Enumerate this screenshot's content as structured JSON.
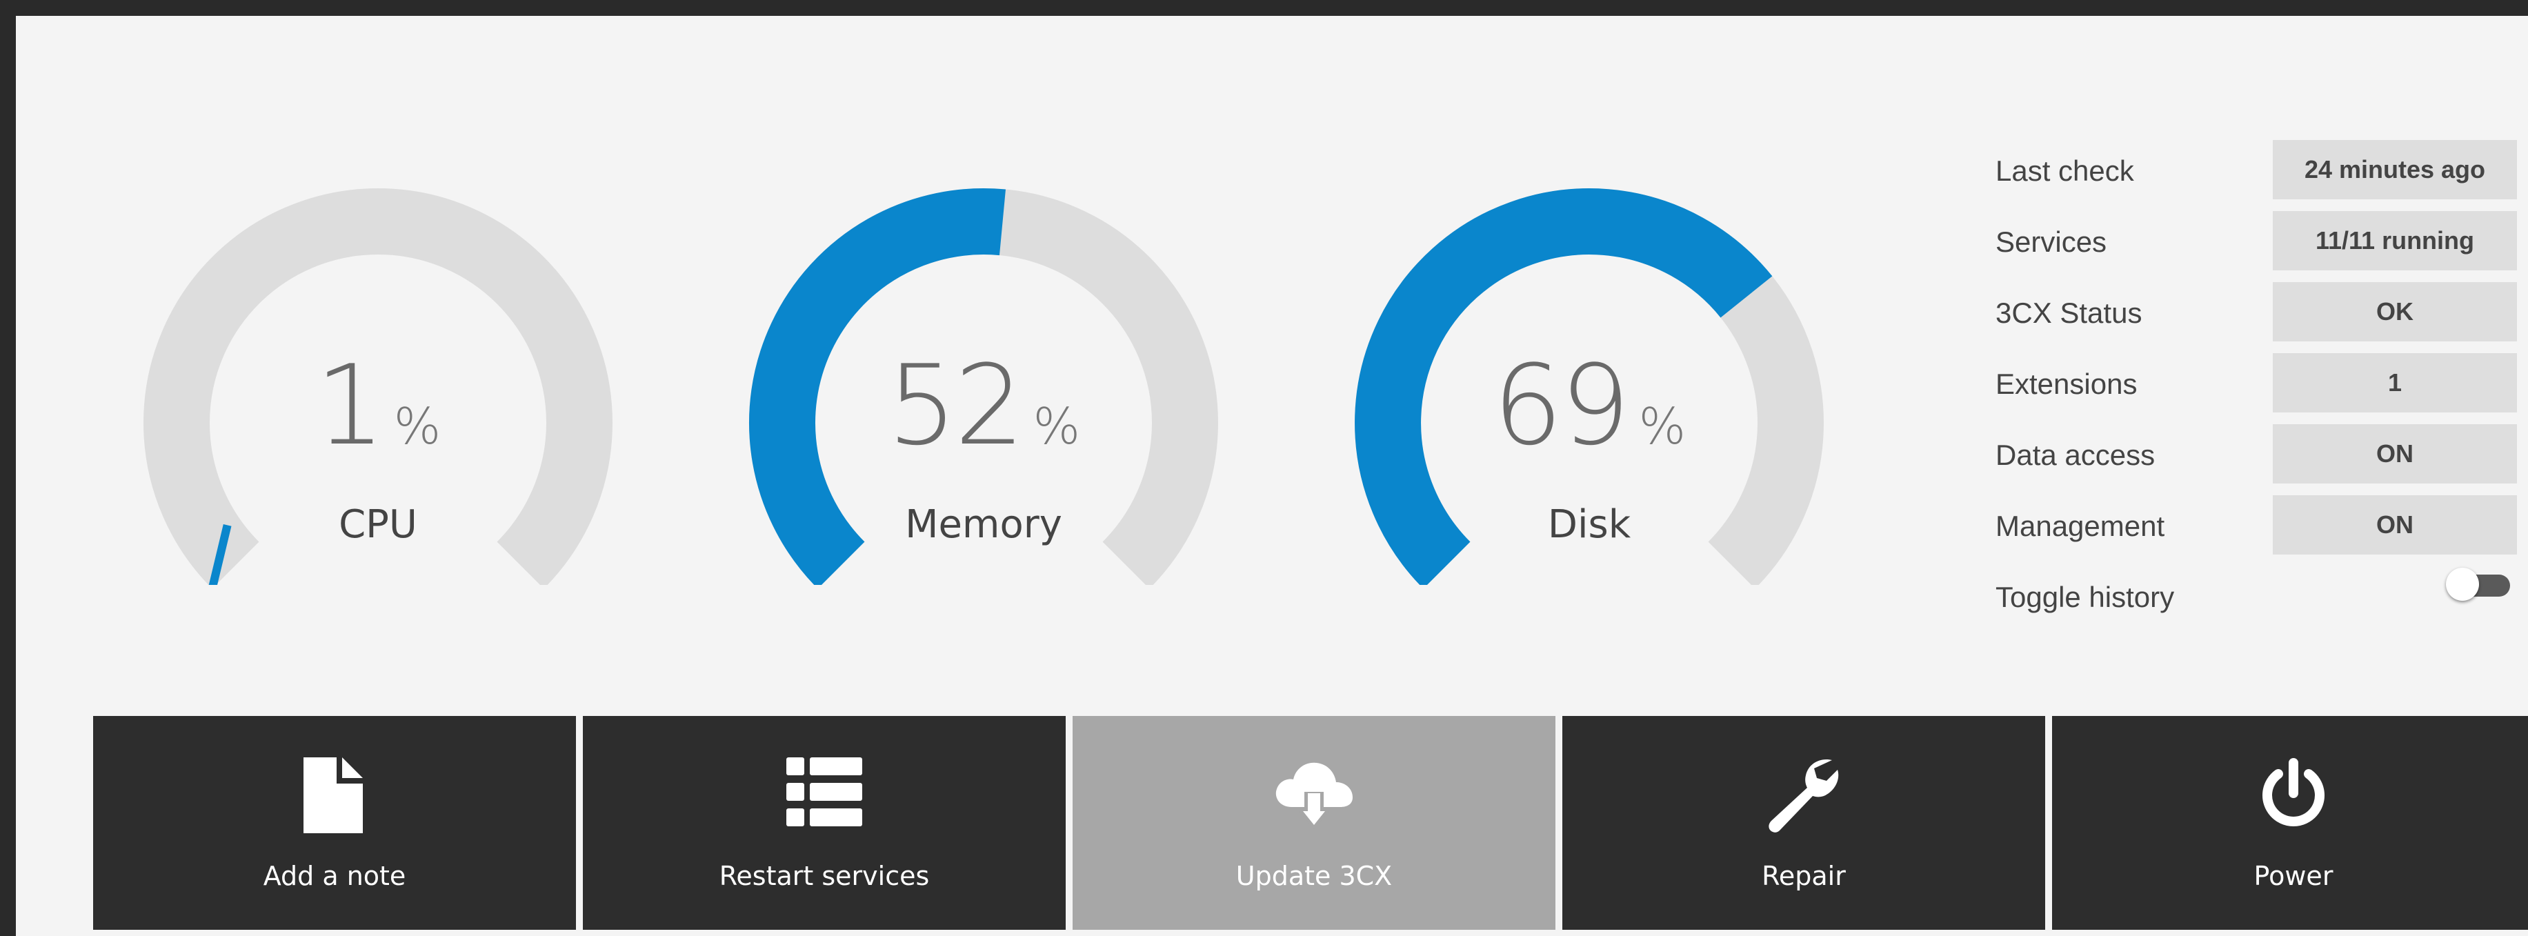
{
  "gauges": [
    {
      "id": "cpu",
      "label": "CPU",
      "value_text": "1",
      "unit": "%",
      "fraction": 0.01
    },
    {
      "id": "memory",
      "label": "Memory",
      "value_text": "52",
      "unit": "%",
      "fraction": 0.52
    },
    {
      "id": "disk",
      "label": "Disk",
      "value_text": "69",
      "unit": "%",
      "fraction": 0.69
    }
  ],
  "info": [
    {
      "label": "Last check",
      "value": "24 minutes ago"
    },
    {
      "label": "Services",
      "value": "11/11 running"
    },
    {
      "label": "3CX Status",
      "value": "OK"
    },
    {
      "label": "Extensions",
      "value": "1"
    },
    {
      "label": "Data access",
      "value": "ON"
    },
    {
      "label": "Management",
      "value": "ON"
    }
  ],
  "toggle_history": {
    "label": "Toggle history",
    "state": "off"
  },
  "actions": [
    {
      "label": "Add a note",
      "icon": "file-icon",
      "enabled": true
    },
    {
      "label": "Restart services",
      "icon": "list-icon",
      "enabled": true
    },
    {
      "label": "Update 3CX",
      "icon": "cloud-download-icon",
      "enabled": false
    },
    {
      "label": "Repair",
      "icon": "wrench-icon",
      "enabled": true
    },
    {
      "label": "Power",
      "icon": "power-icon",
      "enabled": true
    }
  ],
  "colors": {
    "accent": "#0a86cc",
    "track": "#dddddd",
    "button": "#2d2d2d",
    "button_disabled": "#a7a7a7"
  }
}
